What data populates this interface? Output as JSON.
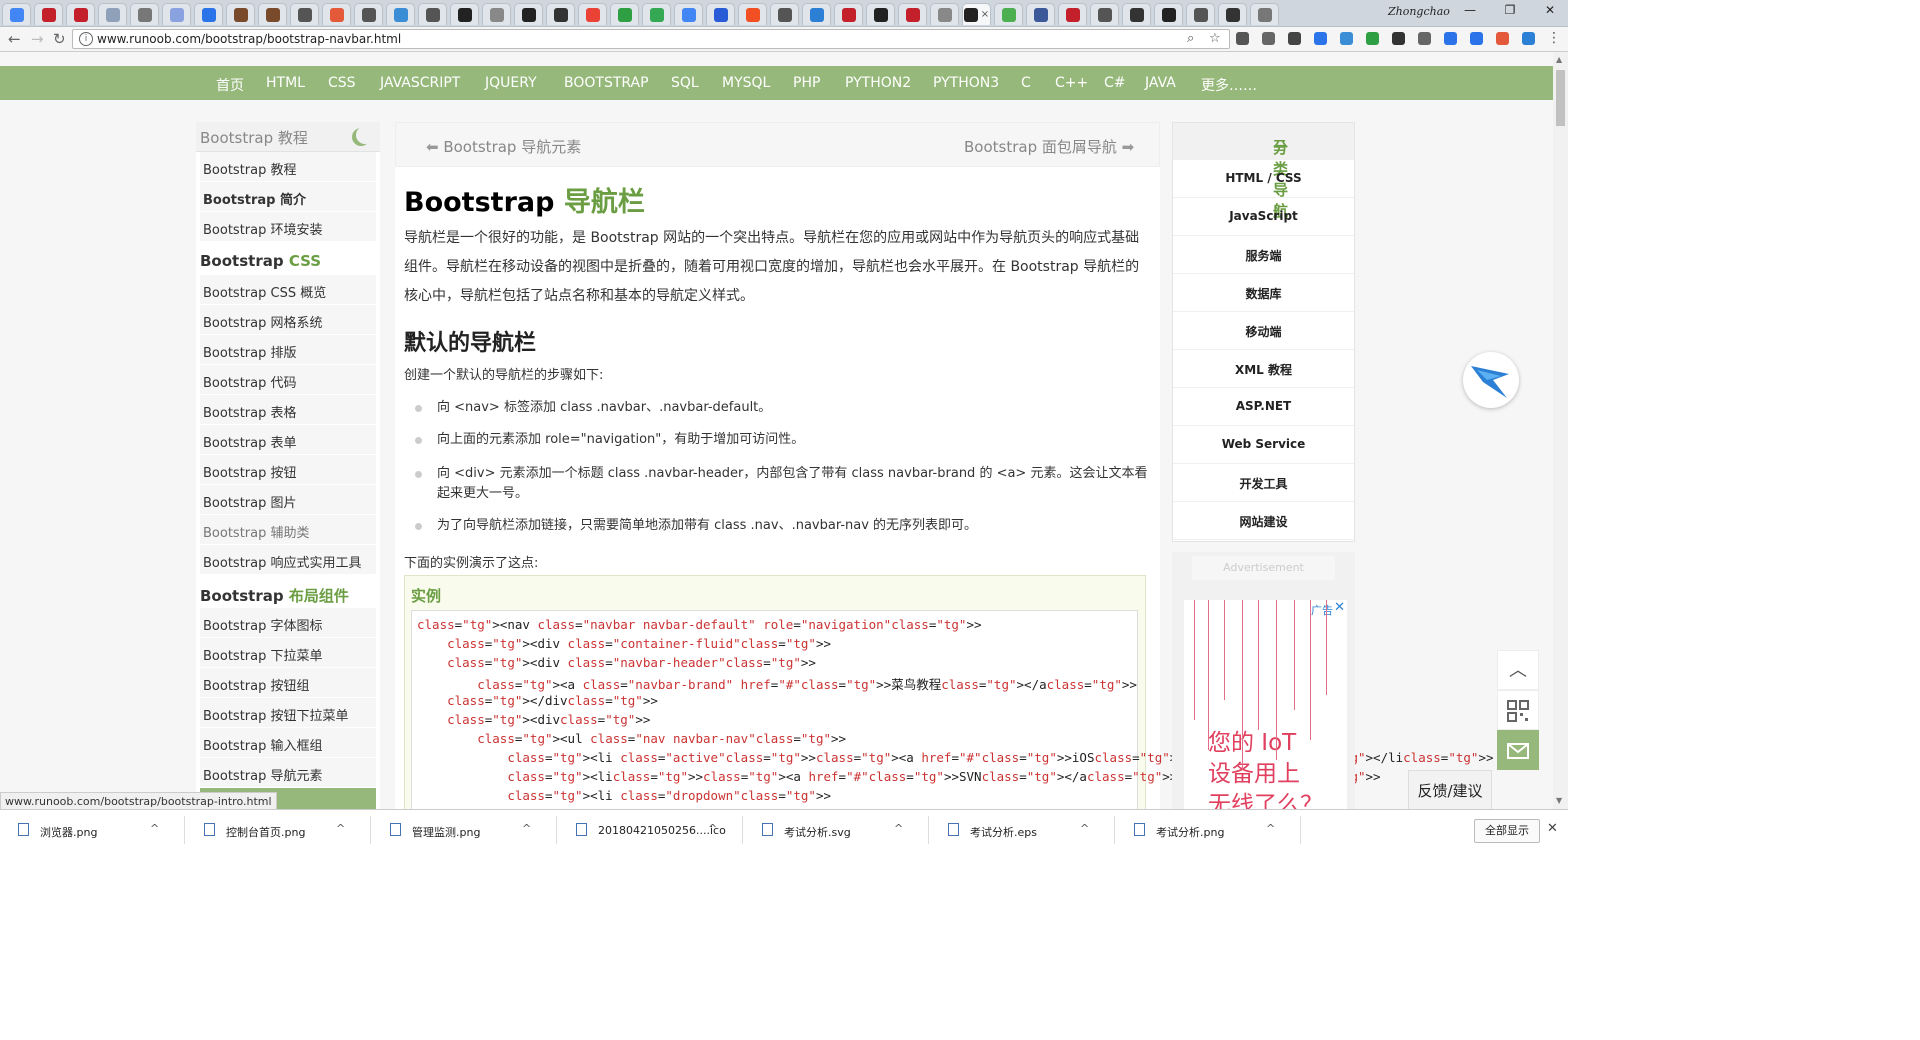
{
  "browser": {
    "user": "Zhongchao",
    "active_tab_close": "×",
    "url": "www.runoob.com/bootstrap/bootstrap-navbar.html",
    "status_url": "www.runoob.com/bootstrap/bootstrap-intro.html"
  },
  "topnav": {
    "items": [
      "首页",
      "HTML",
      "CSS",
      "JAVASCRIPT",
      "JQUERY",
      "BOOTSTRAP",
      "SQL",
      "MYSQL",
      "PHP",
      "PYTHON2",
      "PYTHON3",
      "C",
      "C++",
      "C#",
      "JAVA",
      "更多……"
    ]
  },
  "sidebar": {
    "title": "Bootstrap 教程",
    "items1": [
      "Bootstrap 教程",
      "Bootstrap 简介",
      "Bootstrap 环境安装"
    ],
    "section_css_prefix": "Bootstrap",
    "section_css_accent": "CSS",
    "items2": [
      "Bootstrap CSS 概览",
      "Bootstrap 网格系统",
      "Bootstrap 排版",
      "Bootstrap 代码",
      "Bootstrap 表格",
      "Bootstrap 表单",
      "Bootstrap 按钮",
      "Bootstrap 图片",
      "Bootstrap 辅助类",
      "Bootstrap 响应式实用工具"
    ],
    "section_layout_prefix": "Bootstrap",
    "section_layout_accent": "布局组件",
    "items3": [
      "Bootstrap 字体图标",
      "Bootstrap 下拉菜单",
      "Bootstrap 按钮组",
      "Bootstrap 按钮下拉菜单",
      "Bootstrap 输入框组",
      "Bootstrap 导航元素"
    ]
  },
  "article": {
    "prev": "Bootstrap 导航元素",
    "next": "Bootstrap 面包屑导航",
    "title_prefix": "Bootstrap",
    "title_accent": "导航栏",
    "intro": "导航栏是一个很好的功能，是 Bootstrap 网站的一个突出特点。导航栏在您的应用或网站中作为导航页头的响应式基础组件。导航栏在移动设备的视图中是折叠的，随着可用视口宽度的增加，导航栏也会水平展开。在 Bootstrap 导航栏的核心中，导航栏包括了站点名称和基本的导航定义样式。",
    "h2": "默认的导航栏",
    "steps_intro": "创建一个默认的导航栏的步骤如下:",
    "bullets": [
      "向 <nav> 标签添加 class .navbar、.navbar-default。",
      "向上面的元素添加 role=\"navigation\"，有助于增加可访问性。",
      "向 <div> 元素添加一个标题 class .navbar-header，内部包含了带有 class navbar-brand 的 <a> 元素。这会让文本看起来更大一号。",
      "为了向导航栏添加链接，只需要简单地添加带有 class .nav、.navbar-nav 的无序列表即可。"
    ],
    "example_intro": "下面的实例演示了这点:",
    "example_label": "实例",
    "code": [
      "<nav class=\"navbar navbar-default\" role=\"navigation\">",
      "    <div class=\"container-fluid\">",
      "    <div class=\"navbar-header\">",
      "        <a class=\"navbar-brand\" href=\"#\">菜鸟教程</a>",
      "    </div>",
      "    <div>",
      "        <ul class=\"nav navbar-nav\">",
      "            <li class=\"active\"><a href=\"#\">iOS</a></li>",
      "            <li><a href=\"#\">SVN</a></li>",
      "            <li class=\"dropdown\">"
    ]
  },
  "rightnav": {
    "title": "分类导航",
    "items": [
      "HTML / CSS",
      "JavaScript",
      "服务端",
      "数据库",
      "移动端",
      "XML 教程",
      "ASP.NET",
      "Web Service",
      "开发工具",
      "网站建设"
    ]
  },
  "ad": {
    "label": "Advertisement",
    "tag": "广告",
    "close": "✕",
    "text_lines": [
      "您的 IoT",
      "设备用上",
      "无线了么？"
    ]
  },
  "float": {
    "feedback": "反馈/建议"
  },
  "downloads": {
    "items": [
      "浏览器.png",
      "控制台首页.png",
      "管理监测.png",
      "20180421050256....ico",
      "考试分析.svg",
      "考试分析.eps",
      "考试分析.png"
    ],
    "show_all": "全部显示"
  },
  "colors": {
    "accent_green": "#96b97b",
    "text_green": "#6b9e43"
  }
}
